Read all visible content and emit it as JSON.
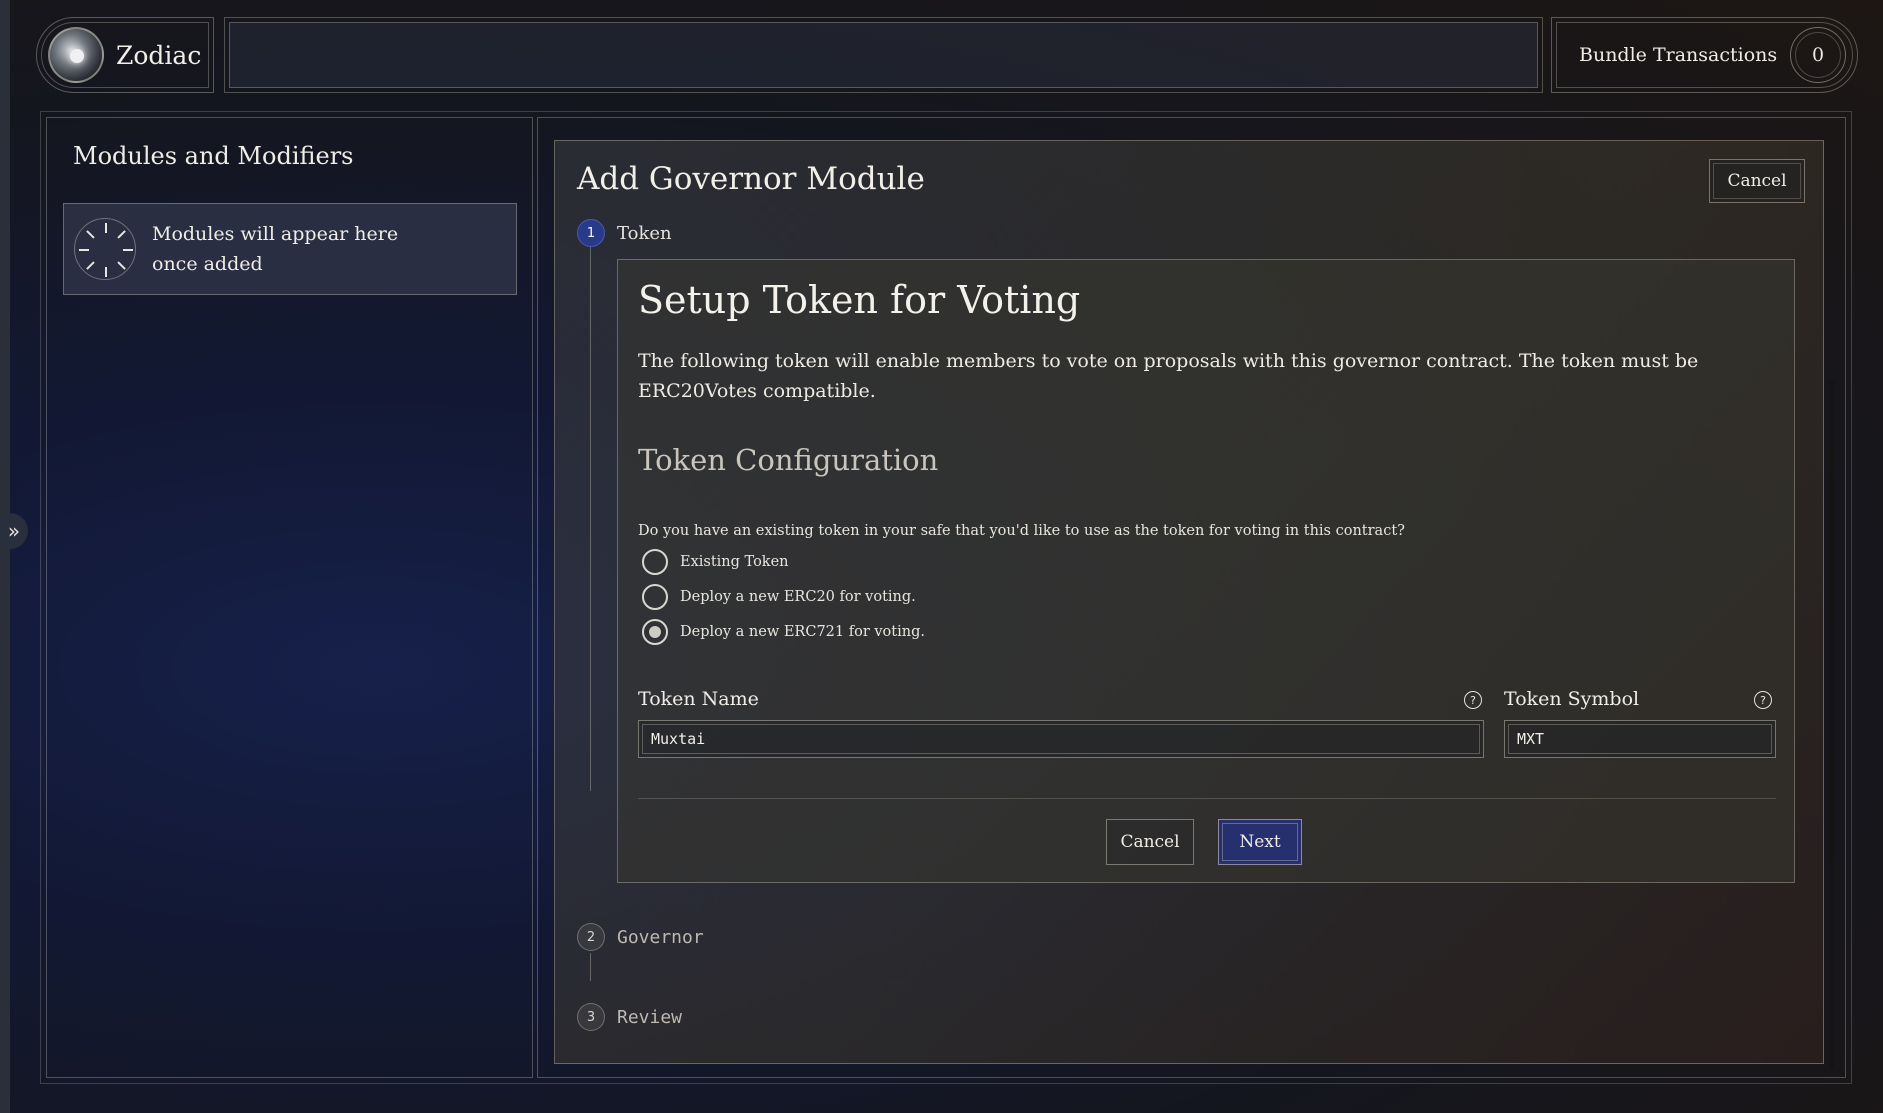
{
  "header": {
    "app_name": "Zodiac",
    "bundle_label": "Bundle Transactions",
    "bundle_count": "0"
  },
  "sidebar": {
    "title": "Modules and Modifiers",
    "empty_text": "Modules will appear here once added"
  },
  "module": {
    "title": "Add Governor Module",
    "cancel_label": "Cancel",
    "steps": [
      {
        "number": "1",
        "label": "Token"
      },
      {
        "number": "2",
        "label": "Governor"
      },
      {
        "number": "3",
        "label": "Review"
      }
    ],
    "token": {
      "title": "Setup Token for Voting",
      "description": "The following token will enable members to vote on proposals with this governor contract. The token must be ERC20Votes compatible.",
      "config_title": "Token Configuration",
      "question": "Do you have an existing token in your safe that you'd like to use as the token for voting in this contract?",
      "options": [
        {
          "label": "Existing Token",
          "selected": false
        },
        {
          "label": "Deploy a new ERC20 for voting.",
          "selected": false
        },
        {
          "label": "Deploy a new ERC721 for voting.",
          "selected": true
        }
      ],
      "name_label": "Token Name",
      "name_value": "Muxtai",
      "symbol_label": "Token Symbol",
      "symbol_value": "MXT",
      "help_glyph": "?",
      "cancel_label": "Cancel",
      "next_label": "Next"
    }
  },
  "icons": {
    "sidebar_toggle": "»"
  },
  "colors": {
    "accent": "#27306e",
    "active_step": "#2a3a8a"
  }
}
